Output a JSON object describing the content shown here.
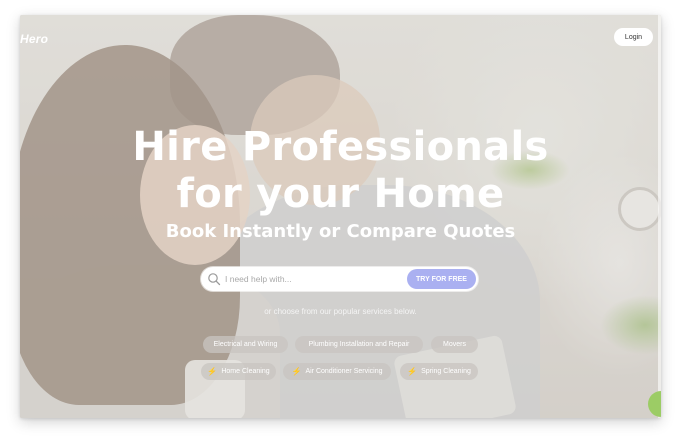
{
  "header": {
    "logo_text": "Hero",
    "login_label": "Login"
  },
  "hero": {
    "title_line1": "Hire Professionals",
    "title_line2": "for your Home",
    "subtitle": "Book Instantly or Compare Quotes"
  },
  "search": {
    "placeholder": "I need help with...",
    "button_label": "TRY FOR FREE"
  },
  "popular": {
    "intro_text": "or choose from our popular services below.",
    "services_row1": [
      {
        "label": "Electrical and Wiring",
        "bolt": false
      },
      {
        "label": "Plumbing Installation and Repair",
        "bolt": false
      },
      {
        "label": "Movers",
        "bolt": false
      }
    ],
    "services_row2": [
      {
        "label": "Home Cleaning",
        "bolt": true
      },
      {
        "label": "Air Conditioner Servicing",
        "bolt": true
      },
      {
        "label": "Spring Cleaning",
        "bolt": true
      }
    ]
  },
  "colors": {
    "accent_button": "#aab0f1",
    "bolt": "#f4c83d",
    "fab": "#9ccc65"
  },
  "icons": {
    "search": "search-icon",
    "bolt": "lightning-bolt-icon"
  }
}
